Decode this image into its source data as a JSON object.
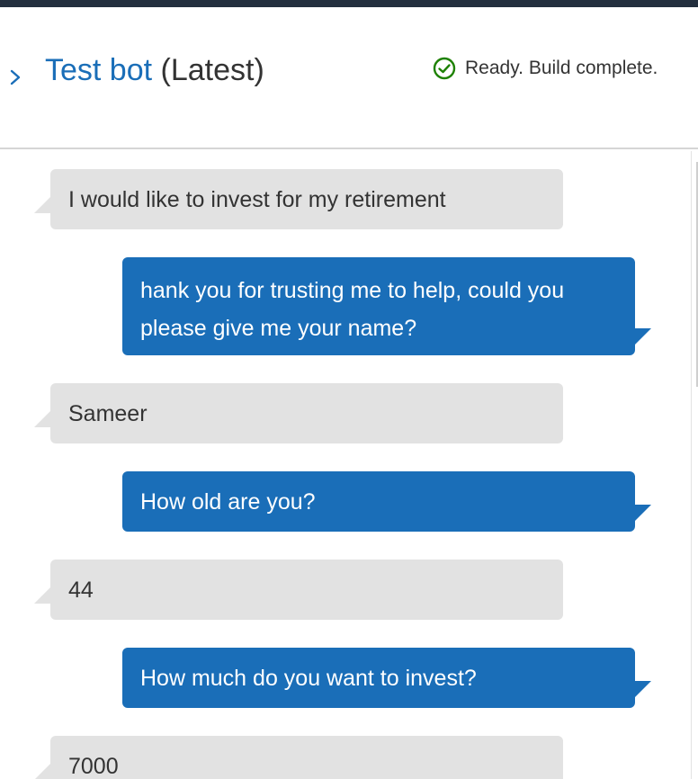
{
  "header": {
    "bot_name": "Test bot",
    "version": "(Latest)",
    "status": "Ready. Build complete.",
    "toggle_icon": "chevron-right-icon",
    "status_icon": "check-circle-icon",
    "colors": {
      "link": "#1a6eb8",
      "success": "#1d8102",
      "user_bubble": "#e2e2e2",
      "bot_bubble": "#1a6eb8"
    }
  },
  "chat": {
    "messages": [
      {
        "sender": "user",
        "text": "I would like to invest for my retirement"
      },
      {
        "sender": "bot",
        "text": "hank you for trusting me to help, could you please give me your name?"
      },
      {
        "sender": "user",
        "text": "Sameer"
      },
      {
        "sender": "bot",
        "text": "How old are you?"
      },
      {
        "sender": "user",
        "text": "44"
      },
      {
        "sender": "bot",
        "text": "How much do you want to invest?"
      },
      {
        "sender": "user",
        "text": "7000"
      }
    ]
  }
}
